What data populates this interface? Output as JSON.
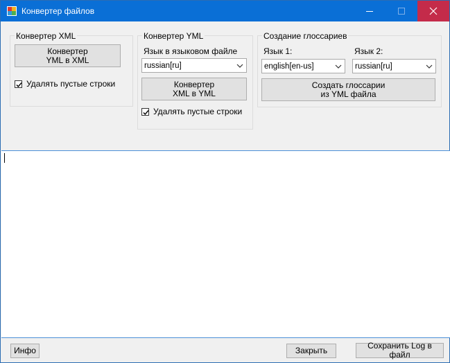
{
  "window": {
    "title": "Конвертер файлов",
    "accent": "#0a6fd6",
    "close_color": "#c42b4a"
  },
  "xml_group": {
    "title": "Конвертер XML",
    "convert_button": "Конвертер\nYML в XML",
    "remove_empty_label": "Удалять пустые строки",
    "remove_empty_checked": true
  },
  "yml_group": {
    "title": "Конвертер YML",
    "language_label": "Язык в языковом файле",
    "language_value": "russian[ru]",
    "convert_button": "Конвертер\nXML в YML",
    "remove_empty_label": "Удалять пустые строки",
    "remove_empty_checked": true
  },
  "glossary_group": {
    "title": "Создание глоссариев",
    "lang1_label": "Язык 1:",
    "lang1_value": "english[en-us]",
    "lang2_label": "Язык 2:",
    "lang2_value": "russian[ru]",
    "create_button": "Создать глоссарии\nиз YML файла"
  },
  "footer": {
    "info_button": "Инфо",
    "close_button": "Закрыть",
    "save_log_button": "Сохранить Log в файл"
  }
}
